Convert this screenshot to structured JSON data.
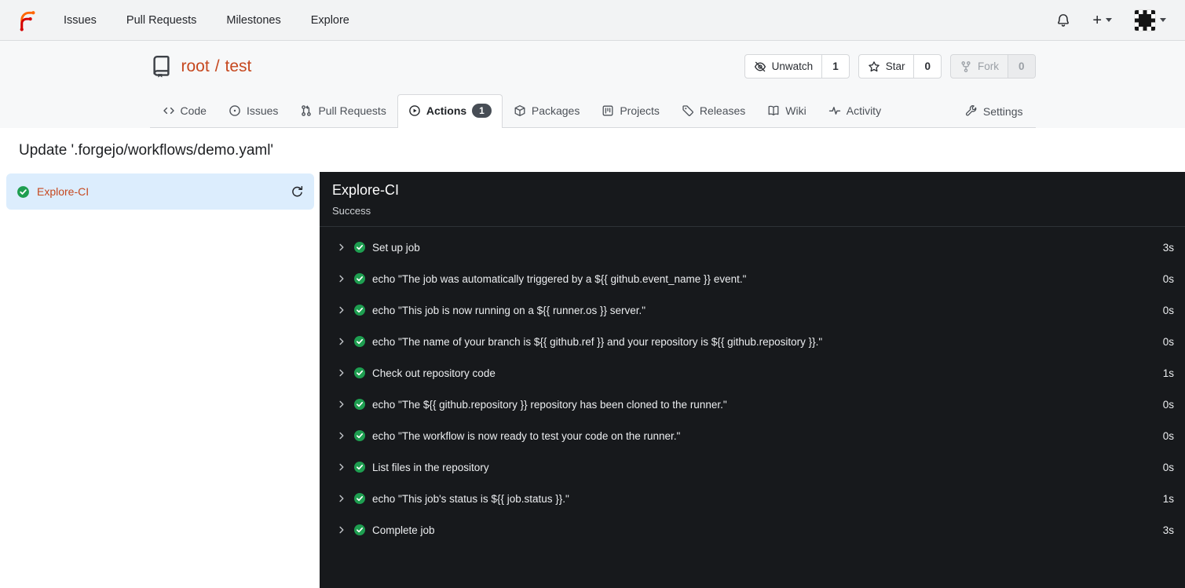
{
  "navbar": {
    "items": [
      {
        "label": "Issues"
      },
      {
        "label": "Pull Requests"
      },
      {
        "label": "Milestones"
      },
      {
        "label": "Explore"
      }
    ],
    "create_label": "+"
  },
  "repo_header": {
    "owner": "root",
    "separator": "/",
    "name": "test",
    "actions": [
      {
        "label": "Unwatch",
        "count": "1",
        "icon": "eye-slash-icon",
        "disabled": false
      },
      {
        "label": "Star",
        "count": "0",
        "icon": "star-icon",
        "disabled": false
      },
      {
        "label": "Fork",
        "count": "0",
        "icon": "fork-icon",
        "disabled": true
      }
    ]
  },
  "tabs": {
    "items": [
      {
        "label": "Code",
        "icon": "code-icon"
      },
      {
        "label": "Issues",
        "icon": "issue-icon"
      },
      {
        "label": "Pull Requests",
        "icon": "pull-request-icon"
      },
      {
        "label": "Actions",
        "icon": "play-circle-icon",
        "active": true,
        "badge": "1"
      },
      {
        "label": "Packages",
        "icon": "package-icon"
      },
      {
        "label": "Projects",
        "icon": "project-icon"
      },
      {
        "label": "Releases",
        "icon": "tag-icon"
      },
      {
        "label": "Wiki",
        "icon": "book-icon"
      },
      {
        "label": "Activity",
        "icon": "pulse-icon"
      }
    ],
    "settings": {
      "label": "Settings",
      "icon": "tools-icon"
    }
  },
  "run": {
    "title": "Update '.forgejo/workflows/demo.yaml'",
    "jobs": [
      {
        "name": "Explore-CI",
        "status": "success",
        "selected": true
      }
    ],
    "detail": {
      "name": "Explore-CI",
      "status": "Success",
      "steps": [
        {
          "name": "Set up job",
          "duration": "3s"
        },
        {
          "name": "echo \"The job was automatically triggered by a ${{ github.event_name }} event.\"",
          "duration": "0s"
        },
        {
          "name": "echo \"This job is now running on a ${{ runner.os }} server.\"",
          "duration": "0s"
        },
        {
          "name": "echo \"The name of your branch is ${{ github.ref }} and your repository is ${{ github.repository }}.\"",
          "duration": "0s"
        },
        {
          "name": "Check out repository code",
          "duration": "1s"
        },
        {
          "name": "echo \"The ${{ github.repository }} repository has been cloned to the runner.\"",
          "duration": "0s"
        },
        {
          "name": "echo \"The workflow is now ready to test your code on the runner.\"",
          "duration": "0s"
        },
        {
          "name": "List files in the repository",
          "duration": "0s"
        },
        {
          "name": "echo \"This job's status is ${{ job.status }}.\"",
          "duration": "1s"
        },
        {
          "name": "Complete job",
          "duration": "3s"
        }
      ]
    }
  },
  "colors": {
    "accent_orange": "#c6481f",
    "success_green": "#1e9e50",
    "selected_blue": "#dcedfd",
    "panel_dark": "#17191c",
    "badge_dark": "#474d55"
  }
}
